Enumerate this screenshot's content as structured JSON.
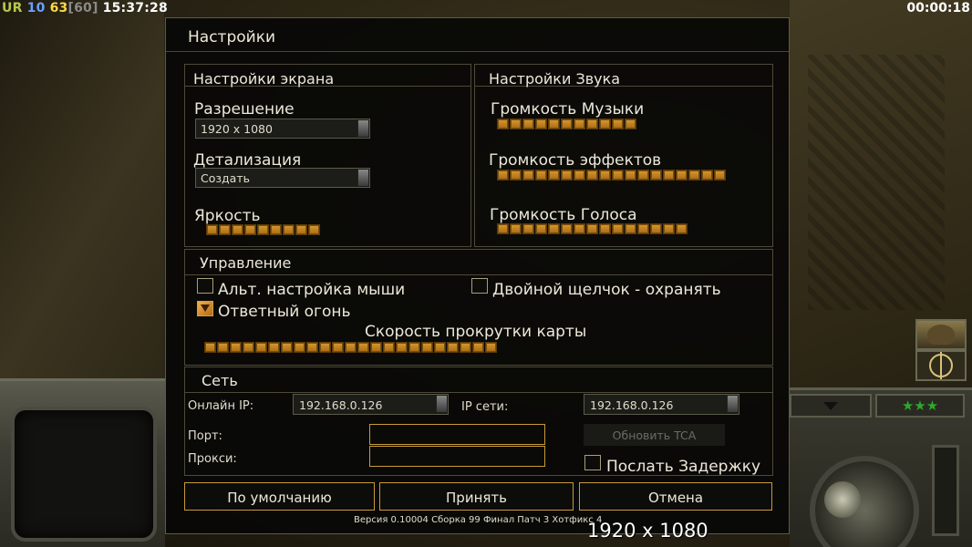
{
  "hud": {
    "ur": "UR",
    "num1": "10",
    "num2": "63",
    "num3": "[60]",
    "clock": "15:37:28",
    "timer": "00:00:18"
  },
  "sidebar": {
    "portrait_icon": "officer-portrait-icon",
    "compass_icon": "compass-icon",
    "stars": "★★★"
  },
  "dialog": {
    "title": "Настройки",
    "display": {
      "title": "Настройки экрана",
      "resolution_label": "Разрешение",
      "resolution_value": "1920 x 1080",
      "detail_label": "Детализация",
      "detail_value": "Создать",
      "brightness_label": "Яркость",
      "brightness_level": 9
    },
    "sound": {
      "title": "Настройки Звука",
      "music_label": "Громкость Музыки",
      "music_level": 11,
      "effects_label": "Громкость эффектов",
      "effects_level": 18,
      "voice_label": "Громкость Голоса",
      "voice_level": 15
    },
    "controls": {
      "title": "Управление",
      "alt_mouse_label": "Альт. настройка мыши",
      "alt_mouse_checked": false,
      "double_click_label": "Двойной щелчок - охранять",
      "double_click_checked": false,
      "return_fire_label": "Ответный огонь",
      "return_fire_checked": true,
      "scroll_speed_label": "Скорость прокрутки карты",
      "scroll_speed_level": 23
    },
    "network": {
      "title": "Сеть",
      "online_ip_label": "Онлайн IP:",
      "online_ip_value": "192.168.0.126",
      "lan_ip_label": "IP сети:",
      "lan_ip_value": "192.168.0.126",
      "port_label": "Порт:",
      "port_value": "",
      "proxy_label": "Прокси:",
      "proxy_value": "",
      "update_tca_label": "Обновить TCA",
      "send_delay_label": "Послать Задержку",
      "send_delay_checked": false
    },
    "buttons": {
      "default": "По умолчанию",
      "accept": "Принять",
      "cancel": "Отмена"
    },
    "version_text": "Версия 0.10004 Сборка 99 Финал Патч 3 Хотфикс 4",
    "tooltip": "1920 x 1080"
  },
  "colors": {
    "slider_fill": "#d89a2e",
    "button_border": "#c89a3a",
    "panel_border": "#4e4a38"
  }
}
